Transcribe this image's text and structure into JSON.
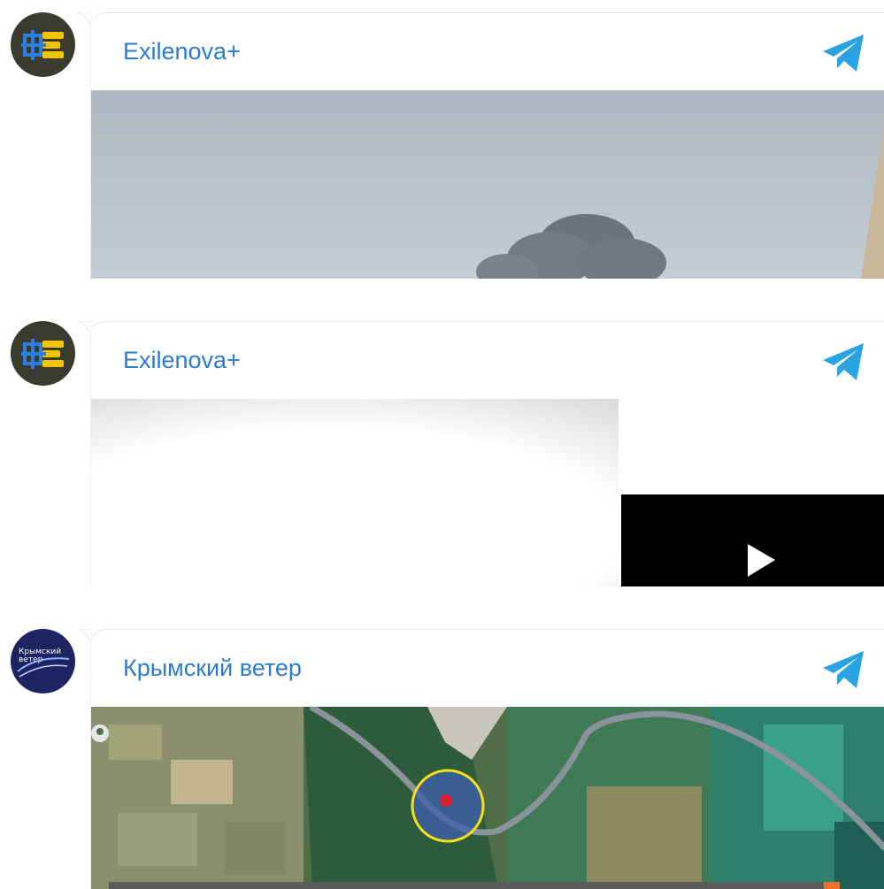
{
  "posts": [
    {
      "channel": "Exilenova+",
      "avatar": "exilenova-logo",
      "media": "smoke-cloud-photo"
    },
    {
      "channel": "Exilenova+",
      "avatar": "exilenova-logo",
      "media": "video-thumbnail"
    },
    {
      "channel": "Крымский ветер",
      "avatar": "krymsky-veter-logo",
      "avatar_text": [
        "Крымский",
        "ветер"
      ],
      "media": "satellite-map"
    }
  ],
  "colors": {
    "channel_name": "#2b7ccf",
    "telegram": "#2aa3e3"
  }
}
